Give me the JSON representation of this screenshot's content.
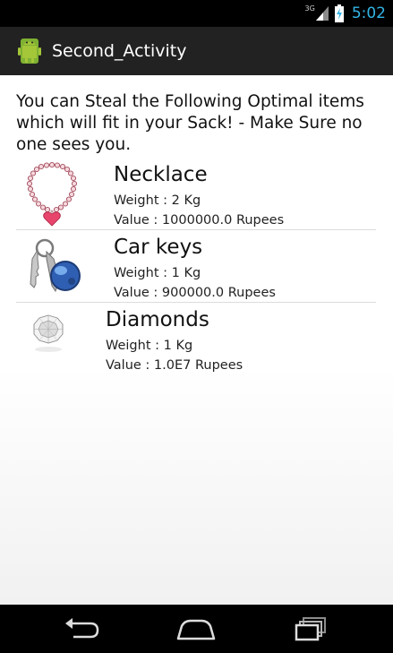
{
  "status_bar": {
    "network": "3G",
    "time": "5:02"
  },
  "action_bar": {
    "title": "Second_Activity",
    "icon": "android-robot-icon"
  },
  "content": {
    "intro": "You can Steal the Following Optimal items which will fit in your Sack! - Make Sure no one sees you.",
    "items": [
      {
        "name": "Necklace",
        "weight": "Weight : 2 Kg",
        "value": "Value : 1000000.0 Rupees",
        "icon": "necklace-image"
      },
      {
        "name": "Car keys",
        "weight": "Weight : 1 Kg",
        "value": "Value : 900000.0 Rupees",
        "icon": "car-keys-image"
      },
      {
        "name": "Diamonds",
        "weight": "Weight : 1 Kg",
        "value": "Value : 1.0E7 Rupees",
        "icon": "diamond-image"
      }
    ]
  },
  "nav_bar": {
    "buttons": [
      "back-icon",
      "home-icon",
      "recent-apps-icon"
    ]
  }
}
